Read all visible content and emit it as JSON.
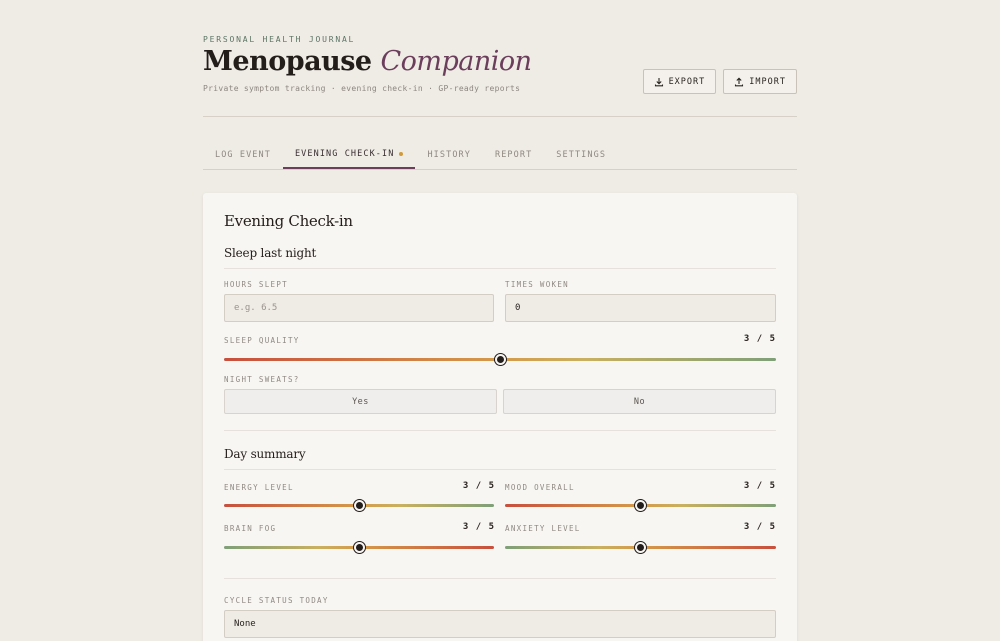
{
  "header": {
    "eyebrow": "PERSONAL HEALTH JOURNAL",
    "title_main": "Menopause",
    "title_accent": "Companion",
    "subtitle": "Private symptom tracking · evening check-in · GP-ready reports",
    "export_label": "EXPORT",
    "import_label": "IMPORT"
  },
  "tabs": [
    {
      "label": "LOG EVENT",
      "active": false
    },
    {
      "label": "EVENING CHECK-IN",
      "active": true,
      "dot": true
    },
    {
      "label": "HISTORY",
      "active": false
    },
    {
      "label": "REPORT",
      "active": false
    },
    {
      "label": "SETTINGS",
      "active": false
    }
  ],
  "card": {
    "title": "Evening Check-in",
    "sleep": {
      "title": "Sleep last night",
      "hours_label": "HOURS SLEPT",
      "hours_placeholder": "e.g. 6.5",
      "hours_value": "",
      "woken_label": "TIMES WOKEN",
      "woken_value": "0",
      "quality_label": "SLEEP QUALITY",
      "quality_display": "3 / 5",
      "quality_value": 3,
      "sweats_label": "NIGHT SWEATS?",
      "sweats_yes": "Yes",
      "sweats_no": "No"
    },
    "day": {
      "title": "Day summary",
      "energy_label": "ENERGY LEVEL",
      "energy_display": "3 / 5",
      "energy_value": 3,
      "mood_label": "MOOD OVERALL",
      "mood_display": "3 / 5",
      "mood_value": 3,
      "fog_label": "BRAIN FOG",
      "fog_display": "3 / 5",
      "fog_value": 3,
      "anxiety_label": "ANXIETY LEVEL",
      "anxiety_display": "3 / 5",
      "anxiety_value": 3
    },
    "cycle": {
      "label": "CYCLE STATUS TODAY",
      "value": "None"
    }
  },
  "colors": {
    "accent": "#6b3f5c",
    "tab_dot": "#d29a3a",
    "eyebrow": "#5d7566"
  },
  "icons": {
    "export": "download-icon",
    "import": "upload-icon"
  }
}
